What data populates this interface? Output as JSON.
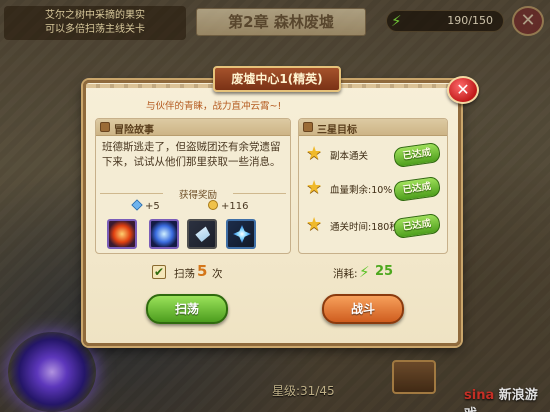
{
  "background": {
    "quest_tip": "艾尔之树中采摘的果实\n可以多倍扫荡主线关卡",
    "chapter_title": "第2章 森林废墟",
    "energy": "190/150",
    "close_symbol": "✕",
    "star_level": "星级:31/45",
    "watermark_prefix": "sina",
    "watermark_text": "新浪游戏"
  },
  "dialog": {
    "title": "废墟中心1(精英)",
    "close_symbol": "✕",
    "hint": "与伙伴的青睐，战力直冲云霄~!",
    "story": {
      "header": "冒险故事",
      "text": "班德斯逃走了，但盗贼团还有余党遗留下来，试试从他们那里获取一些消息。"
    },
    "rewards": {
      "label": "获得奖励",
      "gem_gain": "+5",
      "coin_gain": "+116",
      "items": [
        "fire-orb",
        "water-orb",
        "ice-crystal-shard",
        "blue-star-crystal"
      ]
    },
    "goals": {
      "header": "三星目标",
      "items": [
        {
          "text": "副本通关",
          "badge": "已达成"
        },
        {
          "text": "血量剩余:10%",
          "badge": "已达成"
        },
        {
          "text": "通关时间:180秒",
          "badge": "已达成"
        }
      ]
    },
    "sweep": {
      "checked": true,
      "check_symbol": "✔",
      "label": "扫荡",
      "count": "5",
      "unit": "次"
    },
    "cost": {
      "label": "消耗:",
      "bolt": "⚡",
      "value": "25"
    },
    "buttons": {
      "sweep": "扫荡",
      "battle": "战斗"
    }
  },
  "colors": {
    "accent_green": "#4c9d1e",
    "accent_orange": "#cf5d1f",
    "title_red": "#7a3216"
  }
}
